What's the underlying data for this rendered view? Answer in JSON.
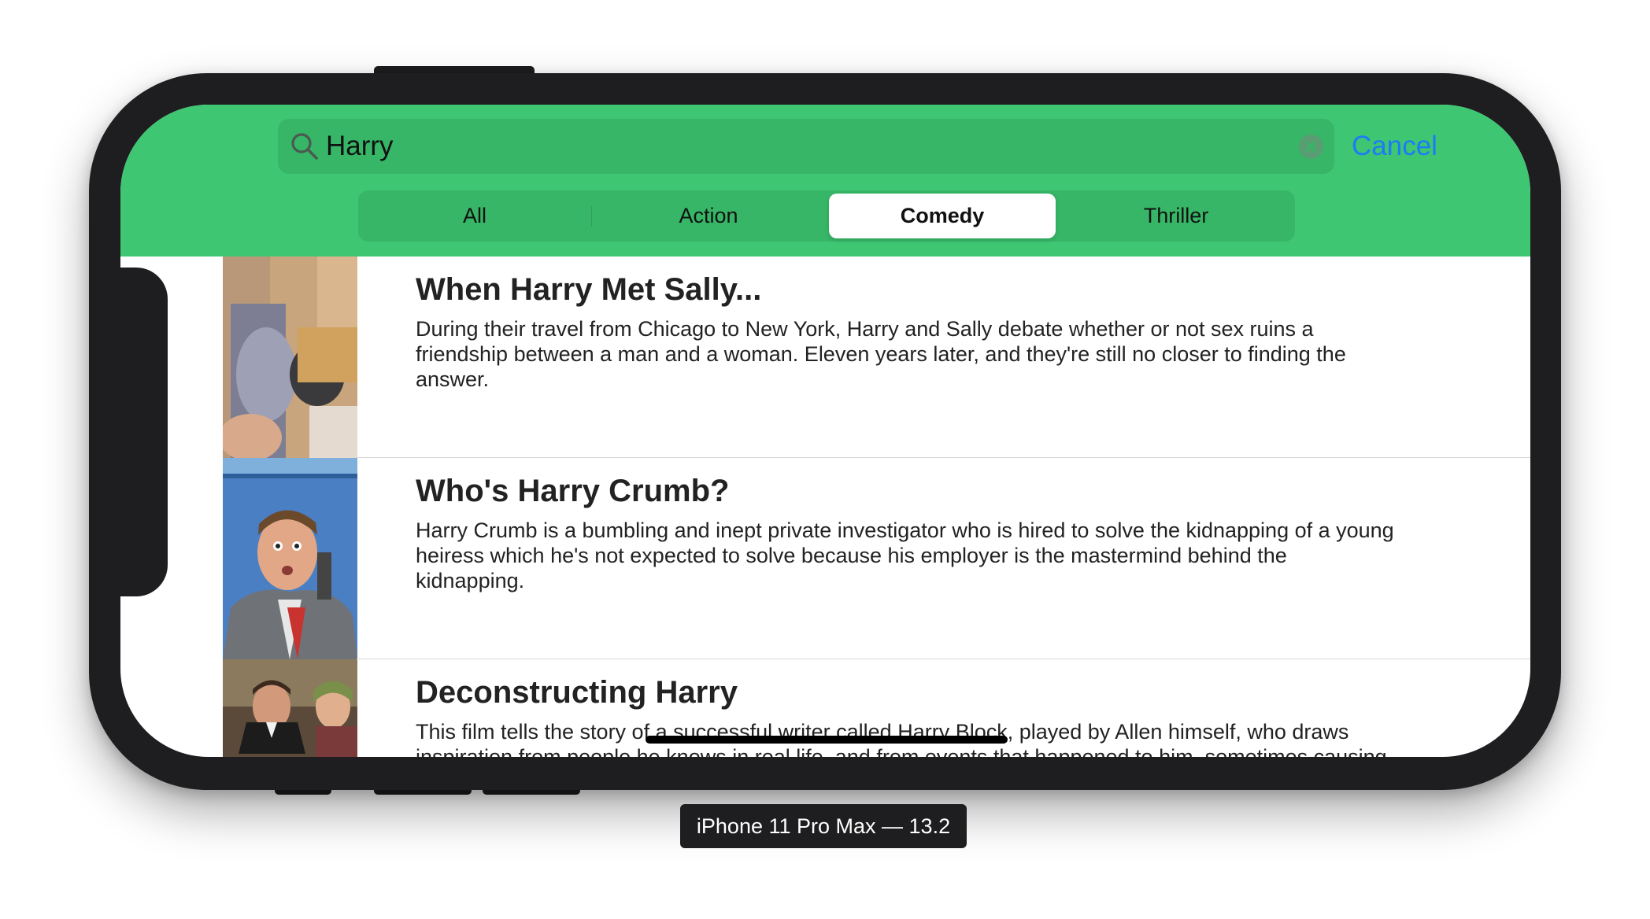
{
  "search": {
    "value": "Harry",
    "cancel_label": "Cancel"
  },
  "scope": {
    "segments": [
      "All",
      "Action",
      "Comedy",
      "Thriller"
    ],
    "selected": "Comedy"
  },
  "movies": [
    {
      "title": "When Harry Met Sally...",
      "description": "During their travel from Chicago to New York, Harry and Sally debate whether or not sex ruins a friendship between a man and a woman. Eleven years later, and they're still no closer to finding the answer."
    },
    {
      "title": "Who's Harry Crumb?",
      "description": "Harry Crumb is a bumbling and inept private investigator who is hired to solve the kidnapping of a young heiress which he's not expected to solve because his employer is the mastermind behind the kidnapping."
    },
    {
      "title": "Deconstructing Harry",
      "description": "This film tells the story of a successful writer called Harry Block, played by Allen himself, who draws inspiration from people he knows in real life, and from events that happened to him, sometimes causing"
    }
  ],
  "device_label": "iPhone 11 Pro Max — 13.2",
  "colors": {
    "nav_background": "#3ec673",
    "accent": "#1c7cf5",
    "phone_frame": "#1e1e20"
  },
  "icons": [
    "search-icon",
    "clear-icon"
  ]
}
